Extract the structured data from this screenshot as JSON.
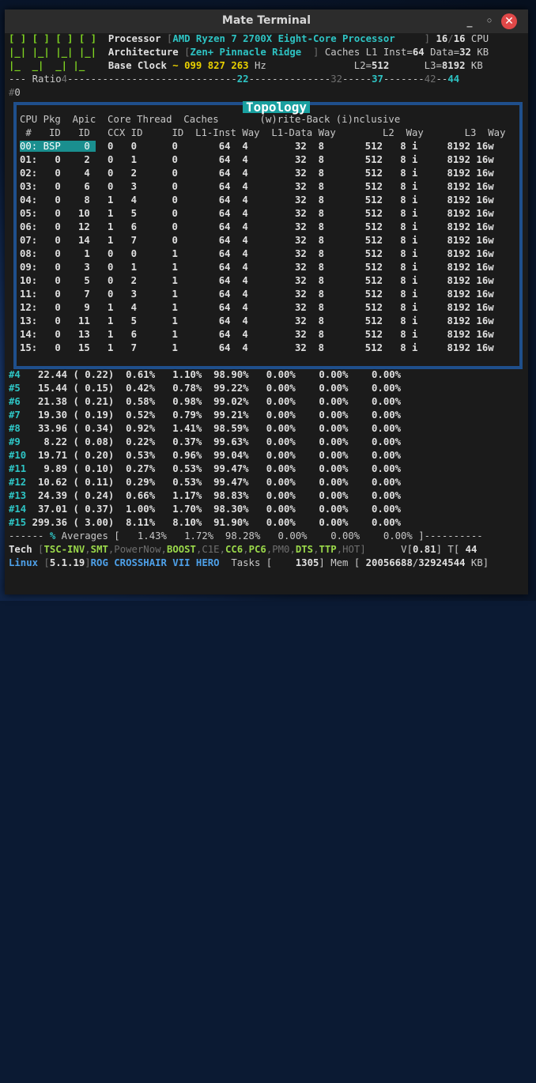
{
  "window": {
    "title": "Mate Terminal",
    "minimize": "_",
    "maximize": "◦",
    "close": "✕"
  },
  "header": [
    [
      [
        "logo",
        "[ ] [ ] [ ] [ ]  "
      ],
      [
        "w",
        "Processor "
      ],
      [
        "gr",
        "["
      ],
      [
        "c",
        "AMD Ryzen 7 2700X Eight-Core Processor"
      ],
      [
        "gr",
        "     ] "
      ],
      [
        "w",
        "16"
      ],
      [
        "gr",
        "/"
      ],
      [
        "w",
        "16 "
      ],
      [
        "d",
        "CPU"
      ]
    ],
    [
      [
        "logo",
        "|_| |_| |_| |_|  "
      ],
      [
        "w",
        "Architecture "
      ],
      [
        "gr",
        "["
      ],
      [
        "c",
        "Zen+ Pinnacle Ridge"
      ],
      [
        "gr",
        "  ] "
      ],
      [
        "d",
        "Caches L1 Inst="
      ],
      [
        "w",
        "64"
      ],
      [
        "d",
        " Data="
      ],
      [
        "w",
        "32"
      ],
      [
        "d",
        " KB"
      ]
    ],
    [
      [
        "logo",
        "|_  _|  _| |_    "
      ],
      [
        "w",
        "Base Clock "
      ],
      [
        "y",
        "~ 099 827 263"
      ],
      [
        "d",
        " Hz               L2="
      ],
      [
        "w",
        "512"
      ],
      [
        "d",
        "      L3="
      ],
      [
        "w",
        "8192"
      ],
      [
        "d",
        " KB"
      ]
    ],
    [
      [
        "d",
        "--- Ratio"
      ],
      [
        "gr",
        "4"
      ],
      [
        "d",
        "-----------------------------"
      ],
      [
        "c",
        "22"
      ],
      [
        "d",
        "--------------"
      ],
      [
        "gr",
        "32"
      ],
      [
        "d",
        "-----"
      ],
      [
        "c",
        "37"
      ],
      [
        "d",
        "-------"
      ],
      [
        "gr",
        "42"
      ],
      [
        "d",
        "--"
      ],
      [
        "c",
        "44"
      ]
    ],
    [
      [
        "gr",
        "#"
      ],
      [
        "d",
        "0"
      ]
    ]
  ],
  "topology": {
    "title": "Topology",
    "head1": "CPU Pkg  Apic  Core Thread  Caches       (w)rite-Back (i)nclusive",
    "head2": " #   ID   ID   CCX ID     ID  L1-Inst Way  L1-Data Way        L2  Way       L3  Way",
    "rows": [
      "00: BSP    0   0   0      0       64  4        32  8       512   8 i     8192 16w",
      "01:   0    2   0   1      0       64  4        32  8       512   8 i     8192 16w",
      "02:   0    4   0   2      0       64  4        32  8       512   8 i     8192 16w",
      "03:   0    6   0   3      0       64  4        32  8       512   8 i     8192 16w",
      "04:   0    8   1   4      0       64  4        32  8       512   8 i     8192 16w",
      "05:   0   10   1   5      0       64  4        32  8       512   8 i     8192 16w",
      "06:   0   12   1   6      0       64  4        32  8       512   8 i     8192 16w",
      "07:   0   14   1   7      0       64  4        32  8       512   8 i     8192 16w",
      "08:   0    1   0   0      1       64  4        32  8       512   8 i     8192 16w",
      "09:   0    3   0   1      1       64  4        32  8       512   8 i     8192 16w",
      "10:   0    5   0   2      1       64  4        32  8       512   8 i     8192 16w",
      "11:   0    7   0   3      1       64  4        32  8       512   8 i     8192 16w",
      "12:   0    9   1   4      1       64  4        32  8       512   8 i     8192 16w",
      "13:   0   11   1   5      1       64  4        32  8       512   8 i     8192 16w",
      "14:   0   13   1   6      1       64  4        32  8       512   8 i     8192 16w",
      "15:   0   15   1   7      1       64  4        32  8       512   8 i     8192 16w"
    ]
  },
  "states": [
    [
      "#4",
      " 22.44 ( 0.22)  0.61%   1.10%  98.90%   0.00%    0.00%    0.00%"
    ],
    [
      "#5",
      " 15.44 ( 0.15)  0.42%   0.78%  99.22%   0.00%    0.00%    0.00%"
    ],
    [
      "#6",
      " 21.38 ( 0.21)  0.58%   0.98%  99.02%   0.00%    0.00%    0.00%"
    ],
    [
      "#7",
      " 19.30 ( 0.19)  0.52%   0.79%  99.21%   0.00%    0.00%    0.00%"
    ],
    [
      "#8",
      " 33.96 ( 0.34)  0.92%   1.41%  98.59%   0.00%    0.00%    0.00%"
    ],
    [
      "#9",
      "  8.22 ( 0.08)  0.22%   0.37%  99.63%   0.00%    0.00%    0.00%"
    ],
    [
      "#10",
      " 19.71 ( 0.20)  0.53%   0.96%  99.04%   0.00%    0.00%    0.00%"
    ],
    [
      "#11",
      "  9.89 ( 0.10)  0.27%   0.53%  99.47%   0.00%    0.00%    0.00%"
    ],
    [
      "#12",
      " 10.62 ( 0.11)  0.29%   0.53%  99.47%   0.00%    0.00%    0.00%"
    ],
    [
      "#13",
      " 24.39 ( 0.24)  0.66%   1.17%  98.83%   0.00%    0.00%    0.00%"
    ],
    [
      "#14",
      " 37.01 ( 0.37)  1.00%   1.70%  98.30%   0.00%    0.00%    0.00%"
    ],
    [
      "#15",
      "299.36 ( 3.00)  8.11%   8.10%  91.90%   0.00%    0.00%    0.00%"
    ]
  ],
  "footer": [
    [
      [
        "d",
        "------ "
      ],
      [
        "c",
        "%"
      ],
      [
        "d",
        " Averages [   1.43%   1.72%  98.28%   0.00%    0.00%    0.00% ]----------"
      ]
    ],
    [
      [
        "w",
        "Tech "
      ],
      [
        "gr",
        "["
      ],
      [
        "g",
        "TSC-INV"
      ],
      [
        "gr",
        ","
      ],
      [
        "g",
        "SMT"
      ],
      [
        "gr",
        ",PowerNow,"
      ],
      [
        "g",
        "BOOST"
      ],
      [
        "gr",
        ",C1E,"
      ],
      [
        "g",
        "CC6"
      ],
      [
        "gr",
        ","
      ],
      [
        "g",
        "PC6"
      ],
      [
        "gr",
        ",PM0,"
      ],
      [
        "g",
        "DTS"
      ],
      [
        "gr",
        ","
      ],
      [
        "g",
        "TTP"
      ],
      [
        "gr",
        ",HOT]"
      ],
      [
        "d",
        "      V["
      ],
      [
        "w",
        "0.81"
      ],
      [
        "d",
        "] T[ "
      ],
      [
        "w",
        "44"
      ]
    ],
    [
      [
        "b",
        "Linux "
      ],
      [
        "gr",
        "["
      ],
      [
        "w",
        "5.1.19"
      ],
      [
        "gr",
        "]"
      ],
      [
        "b",
        "ROG CROSSHAIR VII HERO"
      ],
      [
        "d",
        "  Tasks [    "
      ],
      [
        "w",
        "1305"
      ],
      [
        "d",
        "] Mem [ "
      ],
      [
        "w",
        "20056688"
      ],
      [
        "d",
        "/"
      ],
      [
        "w",
        "32924544"
      ],
      [
        "d",
        " KB]"
      ]
    ]
  ]
}
